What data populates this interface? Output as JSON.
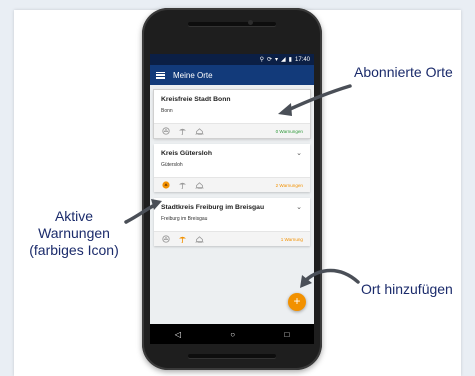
{
  "status_bar": {
    "time": "17:40",
    "icons": [
      "location-icon",
      "sync-icon",
      "wifi-icon",
      "signal-icon",
      "battery-icon"
    ]
  },
  "app_bar": {
    "title": "Meine Orte",
    "menu_icon": "hamburger-menu-icon"
  },
  "cards": [
    {
      "title": "Kreisfreie Stadt Bonn",
      "subtitle": "Bonn",
      "warnings": "0 Warnungen",
      "warnings_color": "#2e9a3a",
      "active_icon": false,
      "chevron": false
    },
    {
      "title": "Kreis Gütersloh",
      "subtitle": "Gütersloh",
      "warnings": "2 Warnungen",
      "warnings_color": "#f29100",
      "active_icon": true,
      "chevron": true
    },
    {
      "title": "Stadtkreis Freiburg im Breisgau",
      "subtitle": "Freiburg im Breisgau",
      "warnings": "1 Warnung",
      "warnings_color": "#f29100",
      "active_icon": false,
      "chevron": true
    }
  ],
  "fab": {
    "label": "+",
    "color": "#f29100"
  },
  "annotations": {
    "abonnierte_orte": "Abonnierte Orte",
    "aktive_line1": "Aktive",
    "aktive_line2": "Warnungen",
    "aktive_line3": "(farbiges Icon)",
    "ort_hinzufuegen": "Ort hinzufügen"
  },
  "colors": {
    "app_bar": "#123a7a",
    "status_bar": "#0b1f45",
    "accent": "#f29100",
    "annotation_text": "#1b2b6b",
    "arrow": "#4a4f57"
  }
}
